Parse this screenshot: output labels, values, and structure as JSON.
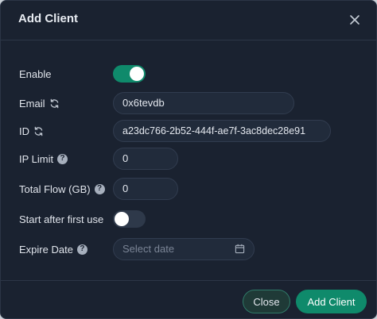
{
  "dialog": {
    "title": "Add Client"
  },
  "form": {
    "enable": {
      "label": "Enable",
      "value": true
    },
    "email": {
      "label": "Email",
      "value": "0x6tevdb"
    },
    "id": {
      "label": "ID",
      "value": "a23dc766-2b52-444f-ae7f-3ac8dec28e91"
    },
    "ip_limit": {
      "label": "IP Limit",
      "value": "0"
    },
    "total_flow": {
      "label": "Total Flow (GB)",
      "value": "0"
    },
    "start_after_first_use": {
      "label": "Start after first use",
      "value": false
    },
    "expire_date": {
      "label": "Expire Date",
      "placeholder": "Select date",
      "value": ""
    }
  },
  "footer": {
    "close_label": "Close",
    "add_label": "Add Client"
  },
  "colors": {
    "accent": "#0f8a6b",
    "background": "#1a2230",
    "field": "#212b3b"
  },
  "icons": {
    "close": "close-icon",
    "sync": "sync-icon",
    "help": "question-circle-icon",
    "calendar": "calendar-icon"
  }
}
